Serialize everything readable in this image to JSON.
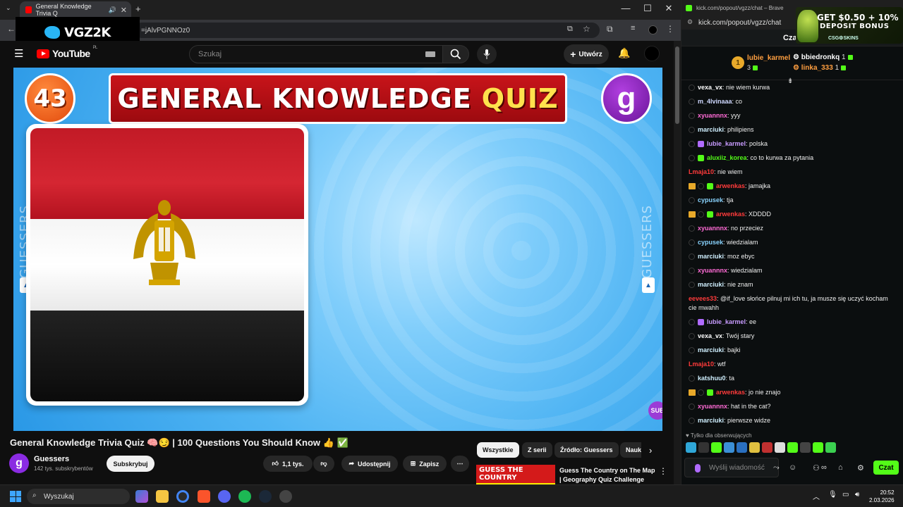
{
  "browser": {
    "tab_title": "General Knowledge Trivia Q",
    "url": "=jAlvPGNNOz0",
    "overlay_logo": "VGZ2K"
  },
  "youtube": {
    "logo_text": "YouTube",
    "region": "PL",
    "search_placeholder": "Szukaj",
    "create_label": "Utwórz"
  },
  "video": {
    "question_number": "43",
    "banner_word1": "GENERAL KNOWLEDGE",
    "banner_word2": "QUIZ",
    "channel_logo_letter": "g",
    "side_text_left": "GUESSERS",
    "side_text_right": "GUESSERS",
    "sub_badge": "SUB",
    "flag_colors": [
      "#ce1126",
      "#ffffff",
      "#000000"
    ]
  },
  "watch": {
    "title": "General Knowledge Trivia Quiz 🧠😏 | 100 Questions You Should Know 👍 ✅",
    "channel_name": "Guessers",
    "channel_subs": "142 tys. subskrybentów",
    "subscribe_label": "Subskrybuj",
    "likes": "1,1 tys.",
    "share_label": "Udostępnij",
    "save_label": "Zapisz",
    "chips": [
      "Wszystkie",
      "Z serii",
      "Źródło: Guessers",
      "Nauk"
    ],
    "rec_thumb_text": "GUESS THE COUNTRY",
    "rec_title": "Guess The Country on The Map | Geography Quiz Challenge"
  },
  "chat": {
    "window_title": "kick.com/popout/vgzz/chat – Brave",
    "url": "kick.com/popout/vgzz/chat",
    "header_label": "Cza",
    "promo_line1": "GET $0.50 + 10%",
    "promo_line2": "DEPOSIT BONUS",
    "promo_brand": "CSG⚙SKINS",
    "leaderboard": [
      {
        "rank": "1",
        "name": "lubie_karmel",
        "count": "3"
      },
      {
        "name": "bbiedronkq",
        "count": "1"
      },
      {
        "name": "linka_333",
        "count": "1"
      }
    ],
    "messages": [
      {
        "user": "vexa_vx",
        "text": ": nie wiem kurwa",
        "color": "#ffffff"
      },
      {
        "user": "m_4lvinaaa",
        "text": ": co",
        "color": "#cfd8ff"
      },
      {
        "user": "xyuannnx",
        "text": ": yyy",
        "color": "#ff6bd6"
      },
      {
        "user": "marciuki",
        "text": ": philipiens",
        "color": "#d0f0ff"
      },
      {
        "user": "lubie_karmel",
        "text": ": polska",
        "color": "#c89bff"
      },
      {
        "user": "aluxiiz_korea",
        "text": ": co to kurwa za pytania",
        "color": "#53fc18"
      },
      {
        "user": "Lmaja10",
        "text": ": nie wiem",
        "color": "#ff3b3b"
      },
      {
        "user": "arwenkas",
        "text": ": jamajka",
        "color": "#ff3b3b"
      },
      {
        "user": "cypusek",
        "text": ": tja",
        "color": "#8ad4ff"
      },
      {
        "user": "arwenkas",
        "text": ": XDDDD",
        "color": "#ff3b3b"
      },
      {
        "user": "xyuannnx",
        "text": ": no przeciez",
        "color": "#ff6bd6"
      },
      {
        "user": "cypusek",
        "text": ": wiedzialam",
        "color": "#8ad4ff"
      },
      {
        "user": "marciuki",
        "text": ": moz ebyc",
        "color": "#d0f0ff"
      },
      {
        "user": "xyuannnx",
        "text": ": wiedzialam",
        "color": "#ff6bd6"
      },
      {
        "user": "marciuki",
        "text": ": nie znam",
        "color": "#d0f0ff"
      },
      {
        "user": "eevees33",
        "text": ": @if_love słońce pilnuj mi ich tu, ja musze się uczyć kocham cie mwahh",
        "color": "#ff3b3b"
      },
      {
        "user": "lubie_karmel",
        "text": ": ee",
        "color": "#c89bff"
      },
      {
        "user": "vexa_vx",
        "text": ": Twój stary",
        "color": "#ffffff"
      },
      {
        "user": "marciuki",
        "text": ": bajki",
        "color": "#d0f0ff"
      },
      {
        "user": "Lmaja10",
        "text": ": wtf",
        "color": "#ff3b3b"
      },
      {
        "user": "katshuu0",
        "text": ": ta",
        "color": "#d0f0ff"
      },
      {
        "user": "arwenkas",
        "text": ": jo nie znajo",
        "color": "#ff3b3b"
      },
      {
        "user": "xyuannnx",
        "text": ": hat in the cat?",
        "color": "#ff6bd6"
      },
      {
        "user": "marciuki",
        "text": ": pierwsze widze",
        "color": "#d0f0ff"
      }
    ],
    "followers_only": "Tylko dla obserwujących",
    "input_placeholder": "Wyślij wiadomość",
    "send_label": "Czat"
  },
  "taskbar": {
    "search_placeholder": "Wyszukaj",
    "time": "20:52",
    "date": "2.03.2026"
  }
}
